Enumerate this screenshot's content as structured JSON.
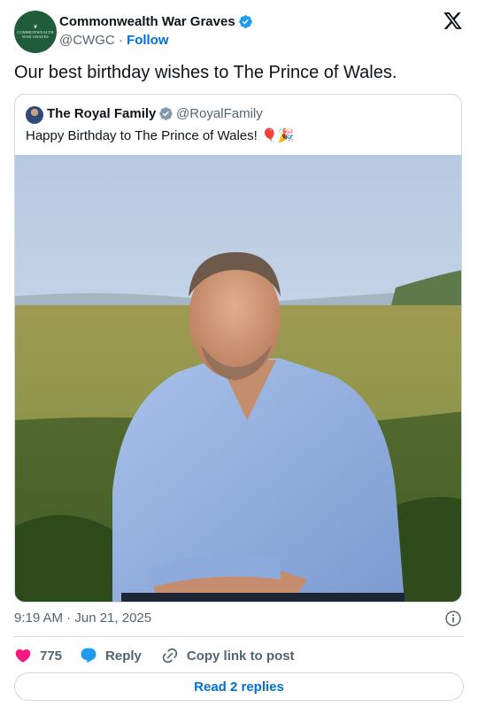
{
  "author": {
    "name": "Commonwealth War Graves",
    "handle": "@CWGC",
    "separator": "·",
    "follow_label": "Follow",
    "avatar_text_line1": "COMMONWEALTH",
    "avatar_text_line2": "WAR GRAVES"
  },
  "tweet": {
    "text": "Our best birthday wishes to The Prince of Wales."
  },
  "quote": {
    "name": "The Royal Family",
    "handle": "@RoyalFamily",
    "text": "Happy Birthday to The Prince of Wales! 🎈🎉"
  },
  "meta": {
    "timestamp": "9:19 AM · Jun 21, 2025"
  },
  "actions": {
    "like_count": "775",
    "reply_label": "Reply",
    "copy_link_label": "Copy link to post"
  },
  "read_replies_label": "Read 2 replies",
  "colors": {
    "link_blue": "#006fd6",
    "like_red": "#f91880",
    "reply_blue": "#1d9bf0",
    "verified_blue": "#1d9bf0",
    "verified_grey": "#829aab",
    "cwgc_green": "#1f5c3a"
  },
  "icons": [
    "verified-badge-icon",
    "x-logo-icon",
    "info-icon",
    "heart-icon",
    "reply-bubble-icon",
    "link-icon"
  ]
}
